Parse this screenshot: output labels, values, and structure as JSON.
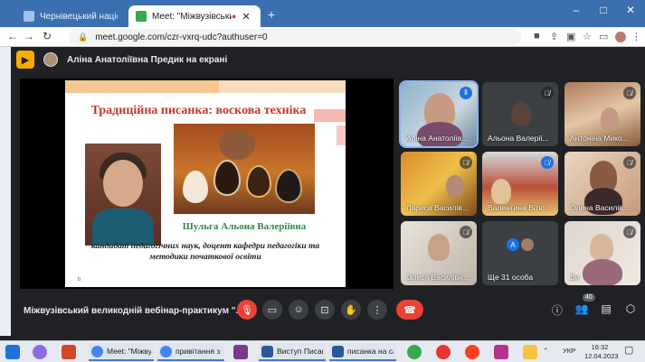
{
  "browser": {
    "tabs": [
      {
        "label": "Чернівецький національний ун",
        "active": false
      },
      {
        "label": "Meet: \"Міжвузівський вели",
        "active": true
      }
    ],
    "new_tab": "+",
    "url": "meet.google.com/czr-vxrq-udc?authuser=0",
    "window_controls": [
      "–",
      "□",
      "✕"
    ]
  },
  "meet": {
    "presenter_label": "Аліна Анатоліївна Предик на екрані",
    "slide": {
      "title": "Традиційна писанка: воскова техніка",
      "speaker": "Шульга Альона Валеріївна",
      "description": "кандидат педагогічних наук, доцент кафедри педагогіки та методики початкової освіти",
      "footer": "b"
    },
    "participants": [
      {
        "name": "Аліна Анатоліїв...",
        "speaking": true
      },
      {
        "name": "Альона Валерії...",
        "speaking": false
      },
      {
        "name": "Антоніна Мико...",
        "speaking": false
      },
      {
        "name": "Лариса Василів...",
        "speaking": false
      },
      {
        "name": "Валентина Вітю...",
        "speaking": false
      },
      {
        "name": "Олена Василів...",
        "speaking": false
      },
      {
        "name": "Олеся Василівн...",
        "speaking": false
      },
      {
        "name": "Ще 31 особа",
        "speaking": false
      },
      {
        "name": "Ви",
        "speaking": false
      }
    ],
    "more_avatar_letter": "A",
    "meeting_title": "Міжвузівський великодній вебінар-практикум \"...",
    "people_count": "40"
  },
  "taskbar": {
    "apps": [
      {
        "label": "Meet: \"Міжвуз..."
      },
      {
        "label": "привітання з п..."
      },
      {
        "label": "Виступ Писанк..."
      },
      {
        "label": "писанка на сай..."
      }
    ],
    "lang": "УКР",
    "time": "16:32",
    "date": "12.04.2023"
  },
  "colors": {
    "accent": "#1a73e8",
    "end_call": "#ea4335",
    "presenting": "#f9ab00"
  }
}
